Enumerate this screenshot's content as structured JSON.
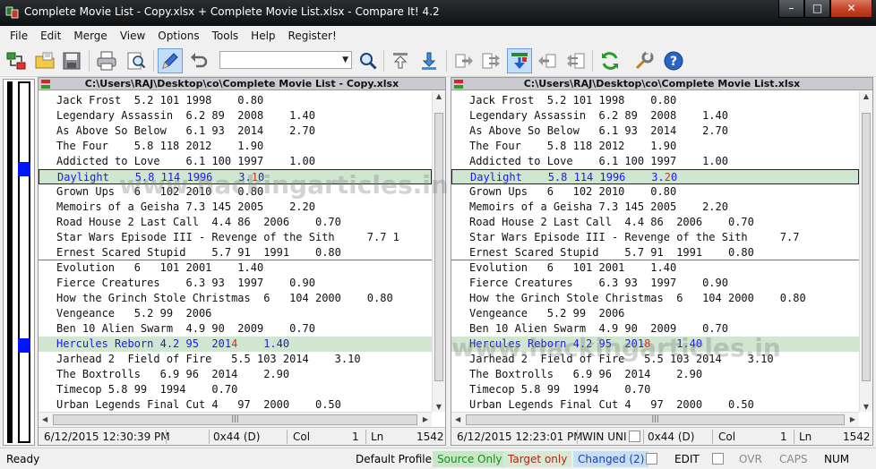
{
  "window": {
    "title": "Complete Movie List - Copy.xlsx + Complete Movie List.xlsx - Compare It! 4.2",
    "minimize": "–",
    "maximize": "□",
    "close": "✕"
  },
  "menu": [
    "File",
    "Edit",
    "Merge",
    "View",
    "Options",
    "Tools",
    "Help",
    "Register!"
  ],
  "toolbar": {
    "search_value": "",
    "icons": [
      "compare-files-icon",
      "open-folder-icon",
      "save-icon",
      "print-icon",
      "find-icon",
      "edit-icon",
      "undo-icon",
      "search-icon",
      "first-change-icon",
      "next-change-icon",
      "copy-right-icon",
      "copy-right-all-icon",
      "sync-icon",
      "copy-left-icon",
      "copy-left-all-icon",
      "refresh-icon",
      "options-icon",
      "help-icon"
    ]
  },
  "colors": {
    "changed_text": "#1a1af0",
    "diff_char": "#e0281c",
    "changed_bg": "#d1e6d1",
    "map_marker": "#0014ff"
  },
  "left_pane": {
    "path": "C:\\Users\\RAJ\\Desktop\\co\\Complete Movie List - Copy.xlsx",
    "lines": [
      {
        "text": "Jack Frost  5.2 101 1998    0.80"
      },
      {
        "text": "Legendary Assassin  6.2 89  2008    1.40"
      },
      {
        "text": "As Above So Below   6.1 93  2014    2.70"
      },
      {
        "text": "The Four    5.8 118 2012    1.90"
      },
      {
        "text": "Addicted to Love    6.1 100 1997    1.00"
      },
      {
        "text": "Daylight    5.8 114 1996    3.10",
        "pre": "Daylight    5.8 114 1996    3.",
        "diff": "1",
        "post": "0"
      },
      {
        "text": "Grown Ups   6   102 2010    0.80"
      },
      {
        "text": "Memoirs of a Geisha 7.3 145 2005    2.20"
      },
      {
        "text": "Road House 2 Last Call  4.4 86  2006    0.70"
      },
      {
        "text": "Star Wars Episode III - Revenge of the Sith     7.7 1"
      },
      {
        "text": "Ernest Scared Stupid    5.7 91  1991    0.80"
      },
      {
        "text": "Evolution   6   101 2001    1.40"
      },
      {
        "text": "Fierce Creatures    6.3 93  1997    0.90"
      },
      {
        "text": "How the Grinch Stole Christmas  6   104 2000    0.80"
      },
      {
        "text": "Vengeance   5.2 99  2006"
      },
      {
        "text": "Ben 10 Alien Swarm  4.9 90  2009    0.70"
      },
      {
        "text": "Hercules Reborn 4.2 95  2014    1.40",
        "pre": "Hercules Reborn 4.2 95  201",
        "diff": "4",
        "post": "    1.40"
      },
      {
        "text": "Jarhead 2  Field of Fire   5.5 103 2014    3.10"
      },
      {
        "text": "The Boxtrolls   6.9 96  2014    2.90"
      },
      {
        "text": "Timecop 5.8 99  1994    0.70"
      },
      {
        "text": "Urban Legends Final Cut 4   97  2000    0.50"
      }
    ],
    "status": {
      "datetime": "6/12/2015 12:30:39 PM",
      "encoding": "",
      "eol": "0x44 (D)",
      "col_label": "Col",
      "col": "1",
      "ln_label": "Ln",
      "ln": "1542"
    }
  },
  "right_pane": {
    "path": "C:\\Users\\RAJ\\Desktop\\co\\Complete Movie List.xlsx",
    "lines": [
      {
        "text": "Jack Frost  5.2 101 1998    0.80"
      },
      {
        "text": "Legendary Assassin  6.2 89  2008    1.40"
      },
      {
        "text": "As Above So Below   6.1 93  2014    2.70"
      },
      {
        "text": "The Four    5.8 118 2012    1.90"
      },
      {
        "text": "Addicted to Love    6.1 100 1997    1.00"
      },
      {
        "text": "Daylight    5.8 114 1996    3.20",
        "pre": "Daylight    5.8 114 1996    3.",
        "diff": "2",
        "post": "0"
      },
      {
        "text": "Grown Ups   6   102 2010    0.80"
      },
      {
        "text": "Memoirs of a Geisha 7.3 145 2005    2.20"
      },
      {
        "text": "Road House 2 Last Call  4.4 86  2006    0.70"
      },
      {
        "text": "Star Wars Episode III - Revenge of the Sith     7.7"
      },
      {
        "text": "Ernest Scared Stupid    5.7 91  1991    0.80"
      },
      {
        "text": "Evolution   6   101 2001    1.40"
      },
      {
        "text": "Fierce Creatures    6.3 93  1997    0.90"
      },
      {
        "text": "How the Grinch Stole Christmas  6   104 2000    0.80"
      },
      {
        "text": "Vengeance   5.2 99  2006"
      },
      {
        "text": "Ben 10 Alien Swarm  4.9 90  2009    0.70"
      },
      {
        "text": "Hercules Reborn 4.2 95  2018    1.40",
        "pre": "Hercules Reborn 4.2 95  201",
        "diff": "8",
        "post": "    1.40"
      },
      {
        "text": "Jarhead 2  Field of Fire   5.5 103 2014    3.10"
      },
      {
        "text": "The Boxtrolls   6.9 96  2014    2.90"
      },
      {
        "text": "Timecop 5.8 99  1994    0.70"
      },
      {
        "text": "Urban Legends Final Cut 4   97  2000    0.50"
      }
    ],
    "status": {
      "datetime": "6/12/2015 12:23:01 PM",
      "encoding": "WIN UNI",
      "eol": "0x44 (D)",
      "col_label": "Col",
      "col": "1",
      "ln_label": "Ln",
      "ln": "1542"
    }
  },
  "statusbar": {
    "ready": "Ready",
    "profile": "Default Profile",
    "source_only": "Source Only",
    "target_only": "Target only",
    "changed": "Changed (2)",
    "edit": "EDIT",
    "ovr": "OVR",
    "caps": "CAPS",
    "num": "NUM"
  },
  "watermark": {
    "left_text": "www.hackingarticles.in",
    "right_text": "www.hackingarticles.in"
  }
}
